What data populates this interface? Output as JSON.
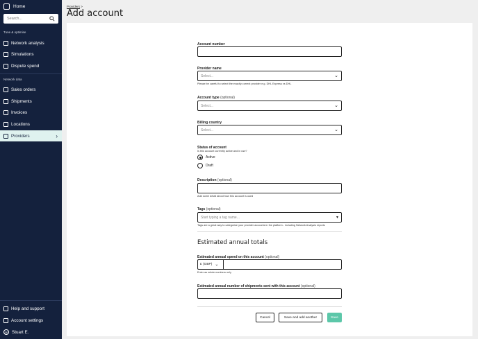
{
  "sidebar": {
    "home": "Home",
    "search_placeholder": "Search...",
    "section_tune": "Tune & optimise",
    "section_network": "Network data",
    "tune_items": [
      "Network analysis",
      "Simulations",
      "Dispute spend"
    ],
    "network_items": [
      "Sales orders",
      "Shipments",
      "Invoices",
      "Locations",
      "Providers"
    ],
    "footer_items": [
      "Help and support",
      "Account settings"
    ],
    "user": "Stuart E.",
    "avatar_initial": "SE"
  },
  "header": {
    "breadcrumb": "Providers",
    "breadcrumb_sep": ">",
    "title": "Add account"
  },
  "form": {
    "account_number": {
      "label": "Account number",
      "value": ""
    },
    "provider_name": {
      "label": "Provider name",
      "placeholder": "Select...",
      "hint": "Please be careful to select the exactly correct provider e.g. DHL Express vs DHL"
    },
    "account_type": {
      "label": "Account type",
      "optional": "(optional)",
      "placeholder": "Select..."
    },
    "billing_country": {
      "label": "Billing country",
      "placeholder": "Select..."
    },
    "status": {
      "label": "Status of account",
      "hint": "Is this account currently active and in use?",
      "options": [
        "Active",
        "Draft"
      ],
      "selected": "Active"
    },
    "description": {
      "label": "Description",
      "optional": "(optional)",
      "hint": "Add some detail about how this account is used"
    },
    "tags": {
      "label": "Tags",
      "optional": "(optional)",
      "placeholder": "Start typing a tag name...",
      "hint": "Tags are a great way to categorise your provider accounts in the platform - including Network Analysis reports"
    },
    "section_title": "Estimated annual totals",
    "annual_spend": {
      "label": "Estimated annual spend on this account",
      "optional": "(optional)",
      "currency": "£ (GBP)",
      "hint": "Enter as whole numbers only"
    },
    "annual_shipments": {
      "label": "Estimated annual number of shipments sent with this account",
      "optional": "(optional)"
    }
  },
  "actions": {
    "cancel": "Cancel",
    "save_another": "Save and add another",
    "save": "Save"
  },
  "colors": {
    "sidebar_bg": "#14213d",
    "accent": "#5cc7a9",
    "active_item_bg": "#dff2ef"
  }
}
